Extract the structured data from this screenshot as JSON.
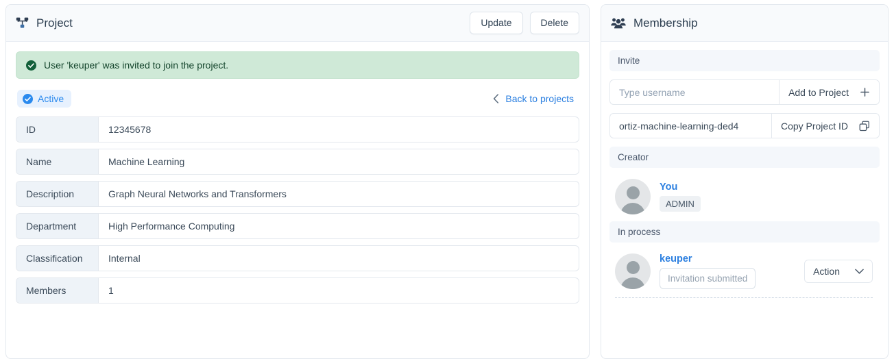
{
  "project_panel": {
    "header": {
      "icon": "project-sitemap-icon",
      "title": "Project",
      "update_label": "Update",
      "delete_label": "Delete"
    },
    "alert": {
      "icon": "check-circle-icon",
      "message": "User 'keuper' was invited to join the project."
    },
    "status": {
      "badge_icon": "check-circle-icon",
      "badge_label": "Active",
      "back_icon": "chevron-left-icon",
      "back_label": "Back to projects"
    },
    "fields": [
      {
        "label": "ID",
        "value": "12345678"
      },
      {
        "label": "Name",
        "value": "Machine Learning"
      },
      {
        "label": "Description",
        "value": "Graph Neural Networks and Transformers"
      },
      {
        "label": "Department",
        "value": "High Performance Computing"
      },
      {
        "label": "Classification",
        "value": "Internal"
      },
      {
        "label": "Members",
        "value": "1"
      }
    ]
  },
  "membership_panel": {
    "header": {
      "icon": "users-icon",
      "title": "Membership"
    },
    "invite": {
      "section_label": "Invite",
      "username_value": "",
      "username_placeholder": "Type username",
      "add_label": "Add to Project",
      "add_icon": "plus-icon",
      "project_id_value": "ortiz-machine-learning-ded4",
      "copy_label": "Copy Project ID",
      "copy_icon": "copy-icon"
    },
    "creator": {
      "section_label": "Creator",
      "avatar": "avatar-placeholder-icon",
      "name": "You",
      "role": "ADMIN"
    },
    "in_process": {
      "section_label": "In process",
      "avatar": "avatar-placeholder-icon",
      "name": "keuper",
      "status": "Invitation submitted",
      "action_label": "Action",
      "action_icon": "chevron-down-icon"
    }
  },
  "colors": {
    "accent_blue": "#2b7fe0",
    "active_blue": "#2b8aee",
    "alert_green_bg": "#cfe9d7",
    "alert_green_fg": "#14452c",
    "label_bg": "#eef3f8",
    "section_bg": "#f4f7fb",
    "border": "#e3e8ee"
  }
}
